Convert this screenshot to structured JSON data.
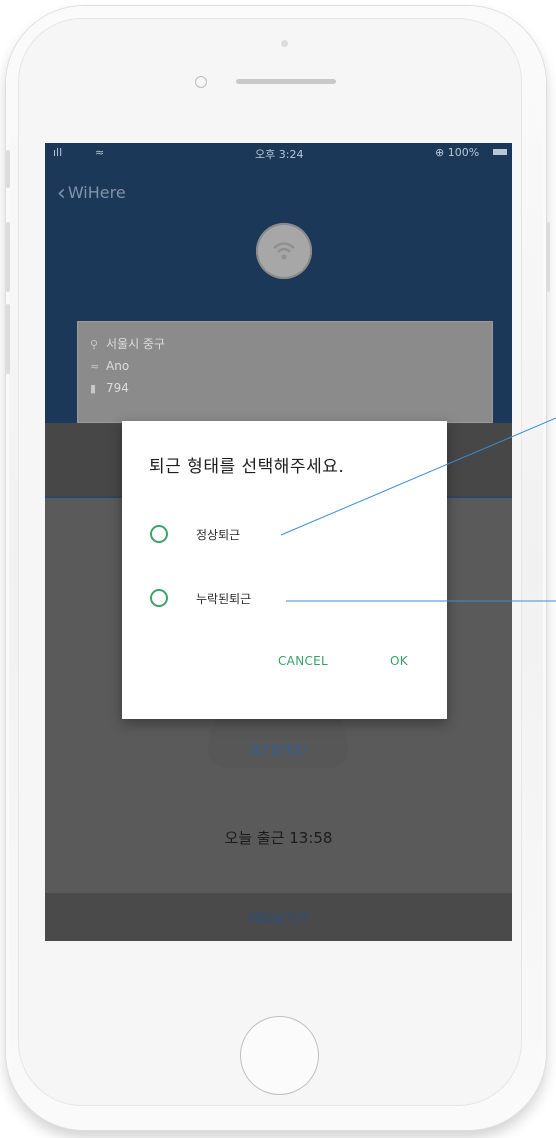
{
  "status_bar": {
    "signal": "ıll",
    "wifi": "≈",
    "time": "오후 3:24",
    "battery": "⊕ 100%"
  },
  "nav": {
    "back_label": "WiHere"
  },
  "info_card": {
    "location": "서울시 중구",
    "network": "Ano",
    "code": "794"
  },
  "dialog": {
    "title": "퇴근 형태를 선택해주세요.",
    "options": [
      "정상퇴근",
      "누락된퇴근"
    ],
    "cancel": "CANCEL",
    "ok": "OK"
  },
  "main": {
    "leave_link": "퇴근할게요!",
    "today_checkin": "오늘 출근 13:58",
    "memo_link": "메모남기기"
  },
  "colors": {
    "header": "#1c3858",
    "accent_green": "#3aa068",
    "pointer_line": "#3a8fd6"
  },
  "icons": {
    "back": "chevron-left-icon",
    "avatar": "wifi-icon",
    "location": "location-pin-icon",
    "network": "wifi-icon",
    "code": "lock-icon"
  }
}
